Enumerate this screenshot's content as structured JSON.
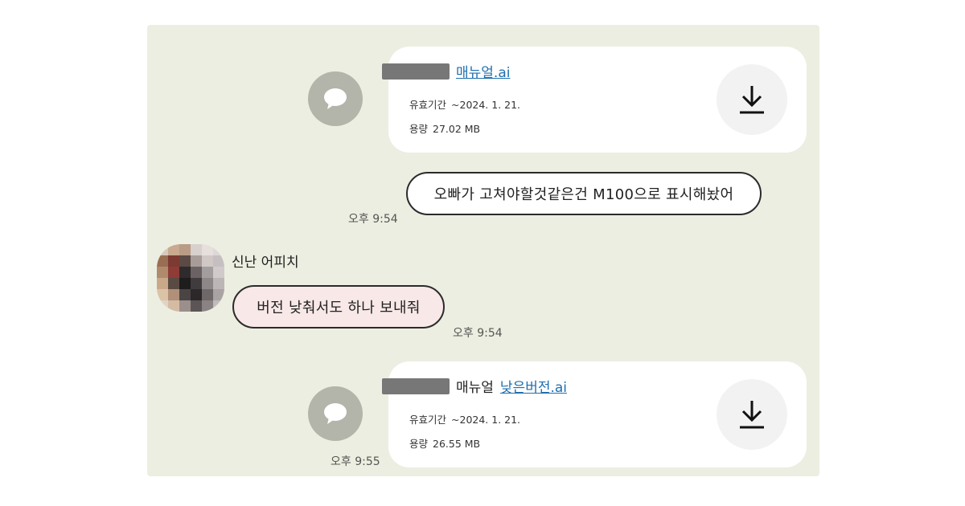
{
  "messages": [
    {
      "type": "file",
      "file_title": "매뉴얼.ai",
      "expiry_label": "유효기간",
      "expiry_value": "~2024. 1. 21.",
      "size_label": "용량",
      "size_value": "27.02 MB"
    },
    {
      "type": "text",
      "direction": "outgoing",
      "text": "오빠가 고쳐야할것같은건 M100으로 표시해놨어",
      "time": "오후 9:54"
    },
    {
      "type": "text",
      "direction": "incoming",
      "sender": "신난 어피치",
      "text": "버전 낮춰서도 하나 보내줘",
      "time": "오후 9:54"
    },
    {
      "type": "file",
      "file_prefix": "매뉴얼",
      "file_title": "낮은버전.ai",
      "expiry_label": "유효기간",
      "expiry_value": "~2024. 1. 21.",
      "size_label": "용량",
      "size_value": "26.55 MB",
      "time": "오후 9:55"
    }
  ],
  "icons": {
    "share": "speech-bubble-icon",
    "download": "download-icon"
  },
  "colors": {
    "chat_background": "#eceee1",
    "link": "#1f6fae",
    "incoming_bubble": "#f8e8e8"
  }
}
